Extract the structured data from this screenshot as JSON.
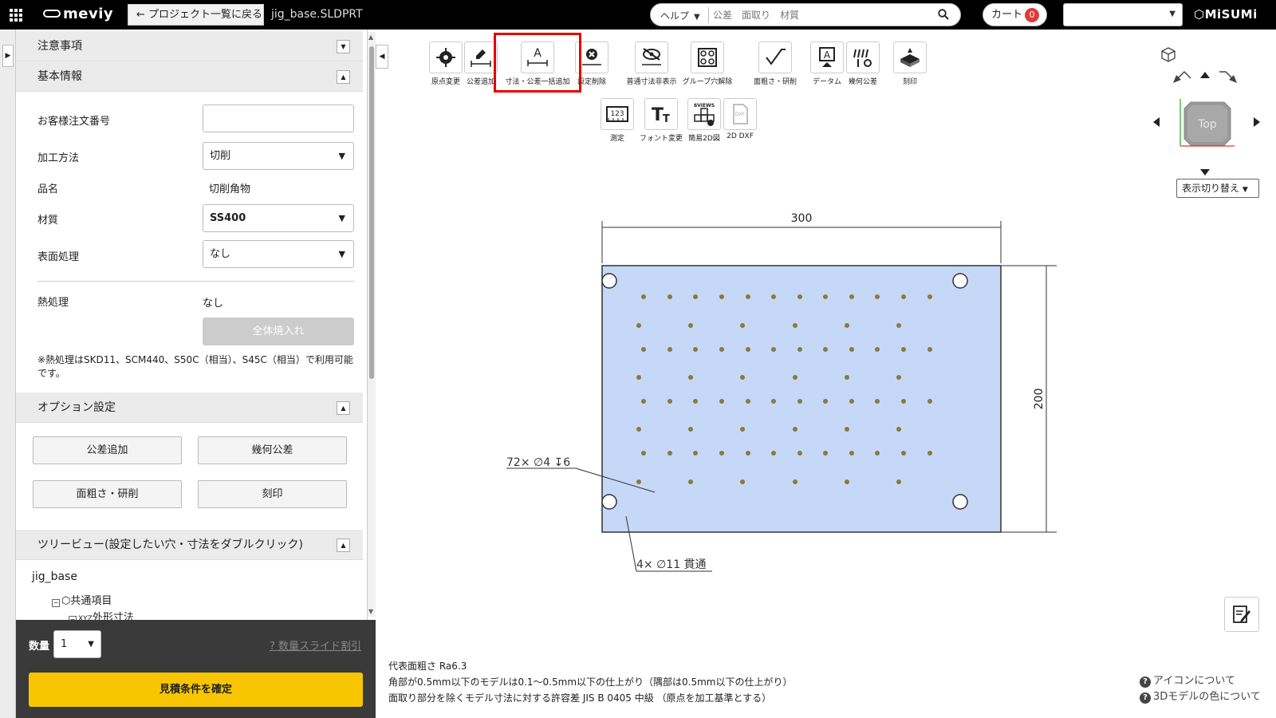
{
  "header": {
    "logo": "meviy",
    "back_label": "プロジェクト一覧に戻る",
    "file_name": "jig_base.SLDPRT",
    "search_category": "ヘルプ",
    "search_placeholder": "公差　面取り　材質",
    "cart_label": "カート",
    "cart_count": "0",
    "brand": "MiSUMi"
  },
  "left": {
    "section_notice": "注意事項",
    "section_basic": "基本情報",
    "fields": {
      "order_no_label": "お客様注文番号",
      "method_label": "加工方法",
      "method_value": "切削",
      "item_label": "品名",
      "item_value": "切削角物",
      "material_label": "材質",
      "material_value": "SS400",
      "surface_label": "表面処理",
      "surface_value": "なし",
      "heat_label": "熱処理",
      "heat_value": "なし",
      "quench_btn": "全体焼入れ"
    },
    "heat_note": "※熱処理はSKD11、SCM440、S50C（相当）、S45C（相当）で利用可能です。",
    "section_option": "オプション設定",
    "options": {
      "tolerance": "公差追加",
      "geometric": "幾何公差",
      "roughness": "面粗さ・研削",
      "engrave": "刻印"
    },
    "section_tree": "ツリービュー(設定したい穴・寸法をダブルクリック)",
    "tree": {
      "root": "jig_base",
      "common": "共通項目",
      "outline": "外形寸法"
    },
    "qty_label": "数量",
    "qty_value": "1",
    "qty_discount": "数量スライド割引",
    "confirm": "見積条件を確定"
  },
  "toolbar": {
    "row1": [
      "原点変更",
      "公差追加",
      "寸法・公差一括追加",
      "設定削除",
      "普通寸法非表示",
      "グループ穴解除",
      "面粗さ・研削",
      "データム",
      "幾何公差",
      "刻印"
    ],
    "row2": [
      "測定",
      "フォント変更",
      "簡易2D図",
      "2D DXF"
    ],
    "measure_icon_text": "123",
    "views_icon_text": "6VIEWS",
    "dxf_icon_text": "DXF"
  },
  "viewer": {
    "cube_face": "Top",
    "view_switch": "表示切り替え"
  },
  "drawing": {
    "width_dim": "300",
    "height_dim": "200",
    "small_hole_note": "72× ∅4 ↧6",
    "large_hole_note": "4× ∅11 貫通",
    "plate_color": "#c5d8f7",
    "small_hole_color": "#8b7a3a"
  },
  "footer": {
    "line1": "代表面粗さ Ra6.3",
    "line2": "角部が0.5mm以下のモデルは0.1～0.5mm以下の仕上がり（隅部は0.5mm以下の仕上がり）",
    "line3": "面取り部分を除くモデル寸法に対する許容差 JIS B 0405 中級 （原点を加工基準とする）",
    "help1": "アイコンについて",
    "help2": "3Dモデルの色について"
  }
}
